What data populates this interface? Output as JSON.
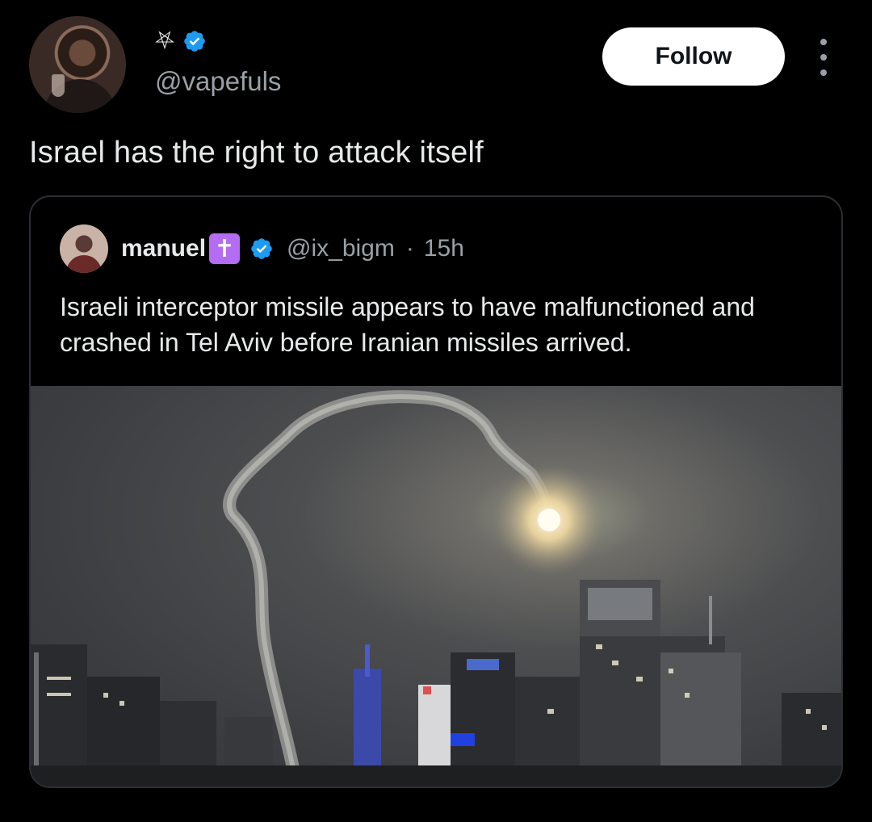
{
  "author": {
    "display_glyph": "⛧",
    "verified_icon": "verified-badge-icon",
    "handle": "@vapefuls",
    "avatar_icon": "user-avatar"
  },
  "actions": {
    "follow_label": "Follow",
    "more_icon": "more-options-icon"
  },
  "tweet": {
    "text": "Israel has the right to attack itself"
  },
  "quoted": {
    "name": "manuel",
    "name_emoji": "✝",
    "handle": "@ix_bigm",
    "separator": "·",
    "time": "15h",
    "text": "Israeli interceptor missile appears to have malfunctioned and crashed in Tel Aviv before Iranian missiles arrived.",
    "media_icon": "night-city-missile-photo"
  },
  "colors": {
    "background": "#000000",
    "text": "#e7e9ea",
    "secondary_text": "#9aa0a6",
    "verified_blue": "#1d9bf0",
    "follow_bg": "#ffffff",
    "emoji_purple": "#b36cf2"
  }
}
